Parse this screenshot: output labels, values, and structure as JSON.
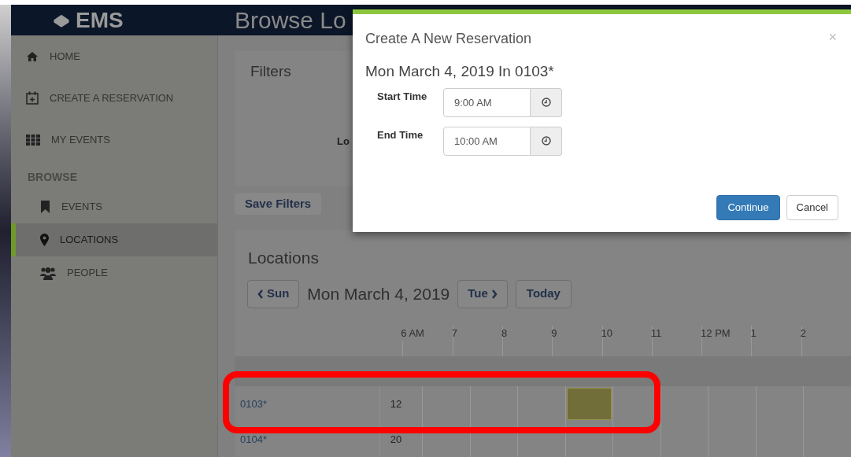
{
  "header": {
    "logo": "EMS",
    "title": "Browse Lo"
  },
  "sidebar": {
    "items": [
      {
        "label": "HOME",
        "selected": false
      },
      {
        "label": "CREATE A RESERVATION",
        "selected": false
      },
      {
        "label": "MY EVENTS",
        "selected": false
      }
    ],
    "section": "BROWSE",
    "browse_items": [
      {
        "label": "EVENTS",
        "selected": false
      },
      {
        "label": "LOCATIONS",
        "selected": true
      },
      {
        "label": "PEOPLE",
        "selected": false
      }
    ]
  },
  "filters": {
    "title": "Filters",
    "label": "Lo",
    "save_button": "Save Filters"
  },
  "locations": {
    "title": "Locations",
    "prev_button": "Sun",
    "date": "Mon March 4, 2019",
    "next_button": "Tue",
    "today_button": "Today",
    "hours": [
      "6 AM",
      "7",
      "8",
      "9",
      "10",
      "11",
      "12 PM",
      "1",
      "2"
    ],
    "rows": [
      {
        "location": "0103*",
        "capacity": "12",
        "slots": [
          {
            "booked": false
          },
          {
            "booked": false
          },
          {
            "booked": false
          },
          {
            "booked": true
          },
          {
            "booked": false
          },
          {
            "booked": false
          },
          {
            "booked": false
          },
          {
            "booked": false
          },
          {
            "booked": false
          }
        ]
      },
      {
        "location": "0104*",
        "capacity": "20",
        "slots": [
          {
            "booked": false
          },
          {
            "booked": false
          },
          {
            "booked": false
          },
          {
            "booked": false
          },
          {
            "booked": false
          },
          {
            "booked": false
          },
          {
            "booked": false
          },
          {
            "booked": false
          },
          {
            "booked": false
          }
        ]
      }
    ]
  },
  "modal": {
    "title": "Create A New Reservation",
    "close": "×",
    "subtitle": "Mon March 4, 2019 In 0103*",
    "fields": [
      {
        "label": "Start Time",
        "value": "9:00 AM"
      },
      {
        "label": "End Time",
        "value": "10:00 AM"
      }
    ],
    "continue_button": "Continue",
    "cancel_button": "Cancel"
  }
}
